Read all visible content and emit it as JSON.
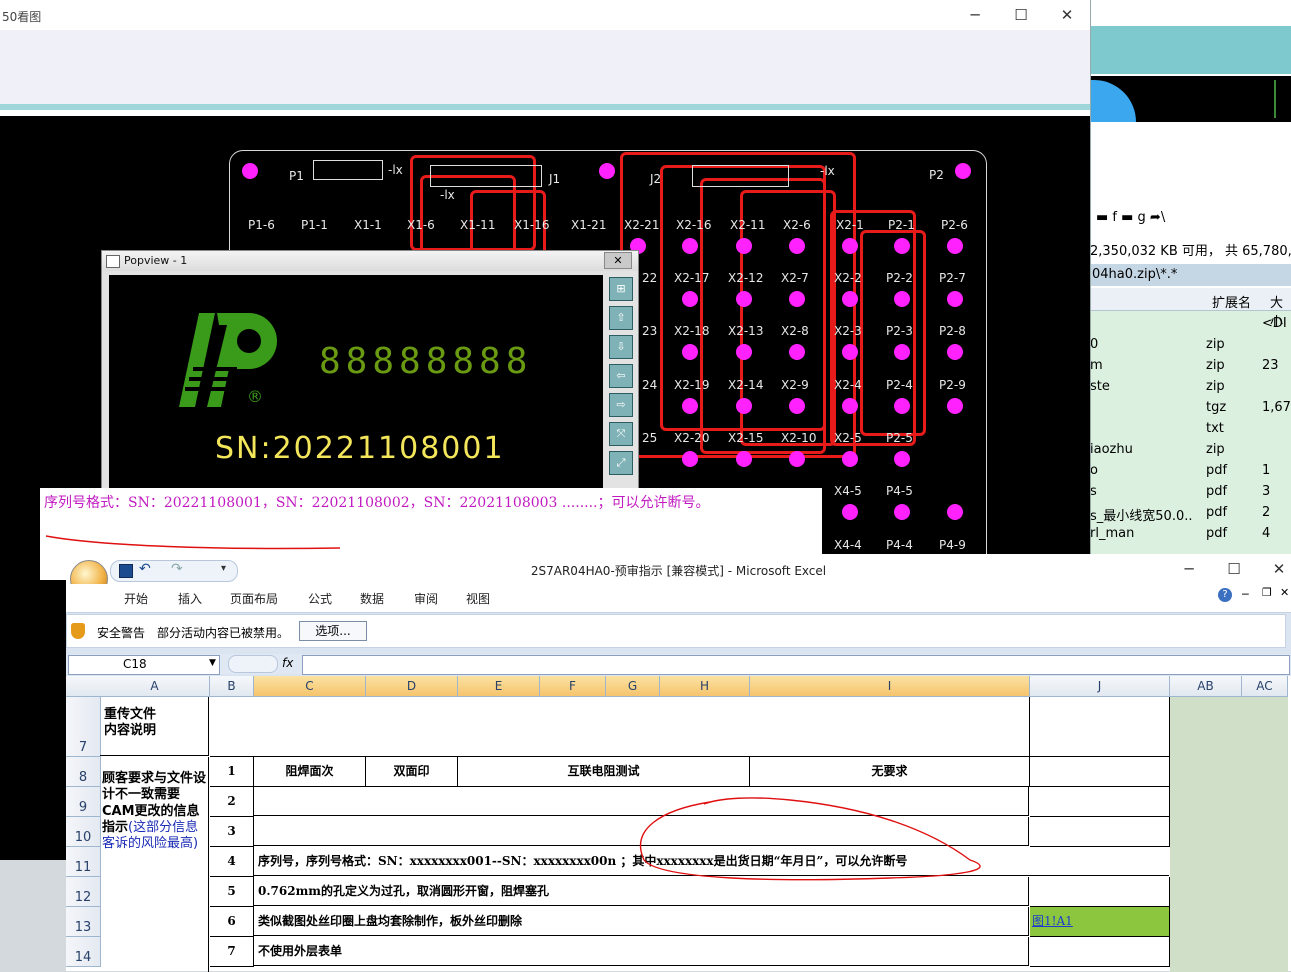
{
  "viewer": {
    "title": "50看图",
    "min": "─",
    "max": "☐",
    "close": "✕"
  },
  "pcb": {
    "top_labels": [
      "P1",
      "J1",
      "J2",
      "P2",
      "-lx",
      "-lx",
      "-lx"
    ],
    "row1": [
      "P1-6",
      "P1-1",
      "X1-1",
      "X1-6",
      "X1-11",
      "X1-16",
      "X1-21",
      "X2-21",
      "X2-16",
      "X2-11",
      "X2-6",
      "X2-1",
      "P2-1",
      "P2-6"
    ],
    "grid_rows": [
      [
        "22",
        "X2-17",
        "X2-12",
        "X2-7",
        "X2-2",
        "P2-2",
        "P2-7"
      ],
      [
        "23",
        "X2-18",
        "X2-13",
        "X2-8",
        "X2-3",
        "P2-3",
        "P2-8"
      ],
      [
        "24",
        "X2-19",
        "X2-14",
        "X2-9",
        "X2-4",
        "P2-4",
        "P2-9"
      ],
      [
        "25",
        "X2-20",
        "X2-15",
        "X2-10",
        "X2-5",
        "P2-5",
        ""
      ],
      [
        "",
        "",
        "",
        "",
        "X4-5",
        "P4-5",
        ""
      ],
      [
        "",
        "",
        "",
        "",
        "X4-4",
        "P4-4",
        "P4-9"
      ]
    ],
    "next_arrow": "→"
  },
  "popview": {
    "title": "Popview - 1",
    "close": "✕",
    "digits": "88888888",
    "registered": "®",
    "sn": "SN:20221108001",
    "side_buttons": [
      "⊞",
      "⇧",
      "⇩",
      "⇦",
      "⇨",
      "⤧",
      "⤢"
    ]
  },
  "note": {
    "text": "序列号格式：SN：20221108001，SN：22021108002，SN：22021108003 ........；可以允许断号。"
  },
  "right_panel": {
    "toolbar": "▬ f  ▬ g  ➦\\",
    "free_space": "2,350,032 KB 可用， 共 65,780,",
    "path": "04ha0.zip\\*.*",
    "header_ext": "扩展名",
    "header_size": "大小",
    "rows": [
      {
        "name": "",
        "ext": "",
        "size": "<DI"
      },
      {
        "name": "0",
        "ext": "zip",
        "size": ""
      },
      {
        "name": "m",
        "ext": "zip",
        "size": "23"
      },
      {
        "name": "ste",
        "ext": "zip",
        "size": ""
      },
      {
        "name": "",
        "ext": "tgz",
        "size": "1,67"
      },
      {
        "name": "",
        "ext": "txt",
        "size": ""
      },
      {
        "name": "iaozhu",
        "ext": "zip",
        "size": ""
      },
      {
        "name": "o",
        "ext": "pdf",
        "size": "1"
      },
      {
        "name": "s",
        "ext": "pdf",
        "size": "3"
      },
      {
        "name": "s_最小线宽50.0..",
        "ext": "pdf",
        "size": "2"
      },
      {
        "name": "rl_man",
        "ext": "pdf",
        "size": "4"
      }
    ]
  },
  "excel": {
    "caption": "2S7AR04HA0-预审指示  [兼容模式] - Microsoft Excel",
    "min": "─",
    "max": "☐",
    "close": "✕",
    "ribbon_tabs": [
      "开始",
      "插入",
      "页面布局",
      "公式",
      "数据",
      "审阅",
      "视图"
    ],
    "security_label": "安全警告",
    "security_text": "部分活动内容已被禁用。",
    "options_button": "选项...",
    "name_box": "C18",
    "fx": "fx",
    "columns": [
      "A",
      "B",
      "C",
      "D",
      "E",
      "F",
      "G",
      "H",
      "I",
      "J",
      "AB",
      "AC"
    ],
    "row_numbers": [
      "7",
      "8",
      "9",
      "10",
      "11",
      "12",
      "13",
      "14"
    ],
    "a7": "重传文件\n内容说明",
    "a_block_black": "顾客要求与文件设计不一致需要CAM更改的信息指示",
    "a_block_blue": "(这部分信息客诉的风险最高)",
    "row8": {
      "b": "1",
      "c": "阻焊面次",
      "d": "双面印",
      "e": "互联电阻测试",
      "i": "无要求"
    },
    "rows": [
      {
        "b": "2",
        "text": ""
      },
      {
        "b": "3",
        "text": ""
      },
      {
        "b": "4",
        "text": "序列号，序列号格式：SN：xxxxxxxx001--SN：xxxxxxxx00n ；其中xxxxxxxx是出货日期“年月日”，可以允许断号"
      },
      {
        "b": "5",
        "text": "0.762mm的孔定义为过孔，取消圆形开窗，阻焊塞孔"
      },
      {
        "b": "6",
        "text": "类似截图处丝印圈上盘均套除制作，板外丝印删除"
      },
      {
        "b": "7",
        "text": "不使用外层表单"
      }
    ],
    "j13_link": "图1!A1"
  }
}
